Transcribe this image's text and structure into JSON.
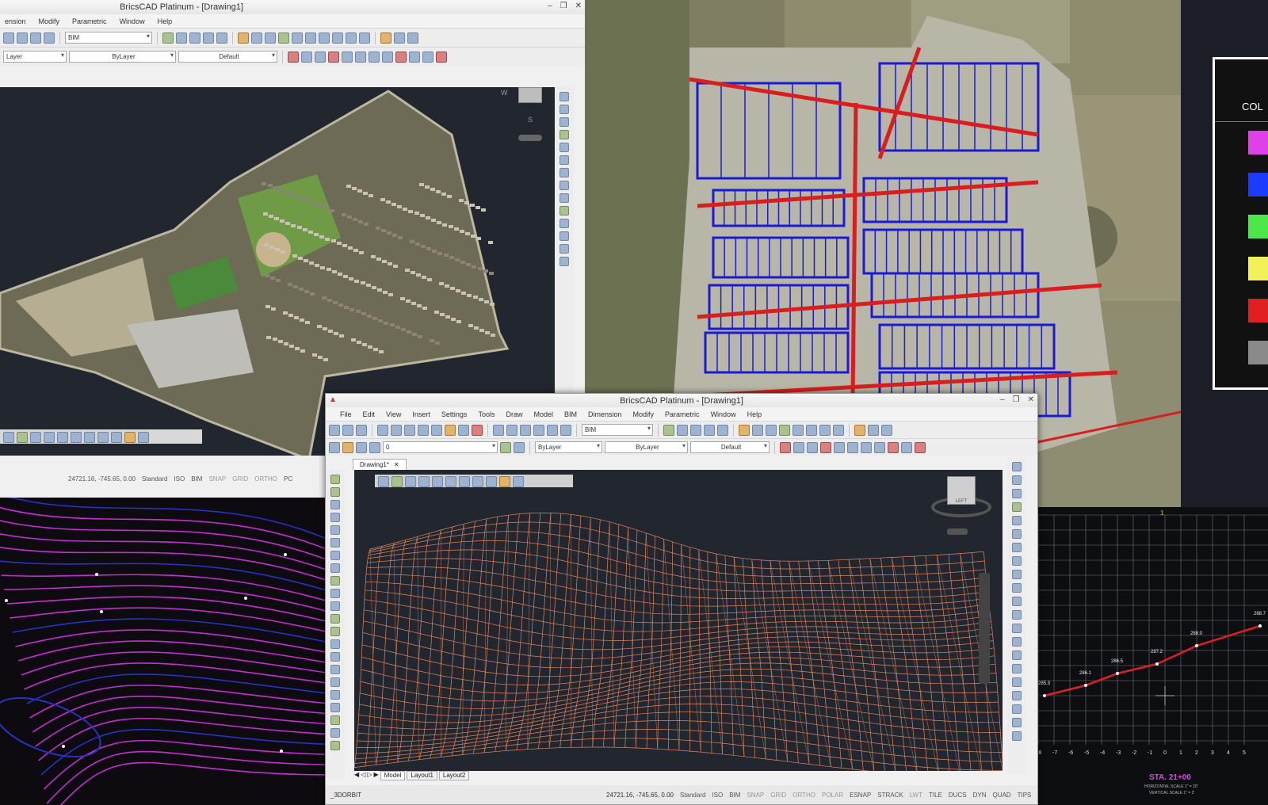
{
  "background_window": {
    "title": "BricsCAD Platinum - [Drawing1]",
    "menu": [
      "ension",
      "Modify",
      "Parametric",
      "Window",
      "Help"
    ],
    "workspace_combo": "BIM",
    "layer_combo": "Layer",
    "linetype_combo": "ByLayer",
    "lineweight_combo": "Default",
    "status": [
      "24721.16, -745.65, 0.00",
      "Standard",
      "ISO",
      "BIM",
      "SNAP",
      "GRID",
      "ORTHO",
      "PC"
    ]
  },
  "front_window": {
    "title": "BricsCAD Platinum - [Drawing1]",
    "menu": [
      "File",
      "Edit",
      "View",
      "Insert",
      "Settings",
      "Tools",
      "Draw",
      "Model",
      "BIM",
      "Dimension",
      "Modify",
      "Parametric",
      "Window",
      "Help"
    ],
    "workspace_combo": "BIM",
    "layer_combo": "0",
    "color_combo": "ByLayer",
    "linetype_combo": "ByLayer",
    "lineweight_combo": "Default",
    "document_tab": "Drawing1*",
    "layout_tabs": [
      "Model",
      "Layout1",
      "Layout2"
    ],
    "command_line": "_3DORBIT",
    "coords": "24721.16, -745.65, 0.00",
    "status": [
      "Standard",
      "ISO",
      "BIM",
      "SNAP",
      "GRID",
      "ORTHO",
      "POLAR",
      "ESNAP",
      "STRACK",
      "LWT",
      "TILE",
      "DUCS",
      "DYN",
      "QUAD",
      "TIPS"
    ],
    "viewcube_label": "LEFT"
  },
  "legend": {
    "header": "COL",
    "swatches": [
      "#e040e8",
      "#1a3cff",
      "#4ce84a",
      "#f3f15a",
      "#e02020",
      "#8a8a8a"
    ]
  },
  "profile": {
    "station_label": "STA. 21+00",
    "scale_h": "HORIZONTAL SCALE 1\" = 20'",
    "scale_v": "VERTICAL SCALE 1\" = 2'",
    "axis_ticks": [
      "-8",
      "-7",
      "-6",
      "-5",
      "-4",
      "-3",
      "-2",
      "-1",
      "0",
      "1",
      "2",
      "3",
      "4",
      "5"
    ],
    "point_labels": [
      "285.3",
      "286.1",
      "286.5",
      "287.2",
      "288.0",
      "288.7"
    ],
    "grid_marker": "1"
  },
  "compass": {
    "w": "W",
    "s": "S"
  },
  "colors": {
    "dark_bg": "#1b1e26",
    "contour": "#c42fd0",
    "contour_blue": "#2a32c0",
    "mesh": "#e08660",
    "parcel_blue": "#1b1bd6",
    "road_red": "#d81e1e"
  }
}
